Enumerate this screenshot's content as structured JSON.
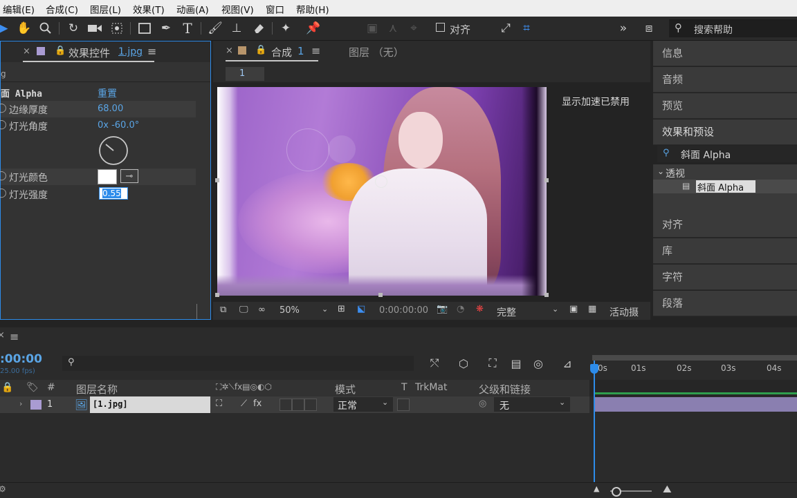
{
  "menu": [
    "编辑(E)",
    "合成(C)",
    "图层(L)",
    "效果(T)",
    "动画(A)",
    "视图(V)",
    "窗口",
    "帮助(H)"
  ],
  "toolbar": {
    "align_label": "对齐",
    "search_help": "搜索帮助"
  },
  "effect_controls": {
    "tab_label": "效果控件",
    "tab_file": "1.jpg",
    "file_short": "g",
    "effect_name": "面 Alpha",
    "reset_label": "重置",
    "props": [
      {
        "label": "边缘厚度",
        "value": "68.00"
      },
      {
        "label": "灯光角度",
        "value": "0x -60.0°"
      },
      {
        "label": "灯光颜色",
        "value": ""
      },
      {
        "label": "灯光强度",
        "value": "0.55"
      }
    ]
  },
  "composition": {
    "tab_label": "合成",
    "tab_num": "1",
    "layer_tab": "图层 （无）",
    "subtab": "1",
    "gpu_notice": "显示加速已禁用",
    "zoom": "50%",
    "timecode": "0:00:00:00",
    "resolution": "完整",
    "camera": "活动摄"
  },
  "right_panel": {
    "items_top": [
      "信息",
      "音频",
      "预览",
      "效果和预设"
    ],
    "search_value": "斜面 Alpha",
    "tree_folder": "透视",
    "tree_item": "斜面 Alpha",
    "items_bottom": [
      "对齐",
      "库",
      "字符",
      "段落"
    ]
  },
  "timeline": {
    "timecode": ":00:00",
    "fps_hint": "25.00 fps)",
    "columns": {
      "hash": "#",
      "layer_name": "图层名称",
      "mode": "模式",
      "t": "T",
      "trkmat": "TrkMat",
      "parent": "父级和链接"
    },
    "ruler": [
      "0s",
      "01s",
      "02s",
      "03s",
      "04s"
    ],
    "layers": [
      {
        "num": "1",
        "name": "[1.jpg]",
        "mode": "正常",
        "parent": "无"
      }
    ]
  },
  "colors": {
    "accent": "#2d8ceb",
    "panel": "#3a3a3a",
    "background": "#232323",
    "layer_label": "#a99bd2"
  }
}
